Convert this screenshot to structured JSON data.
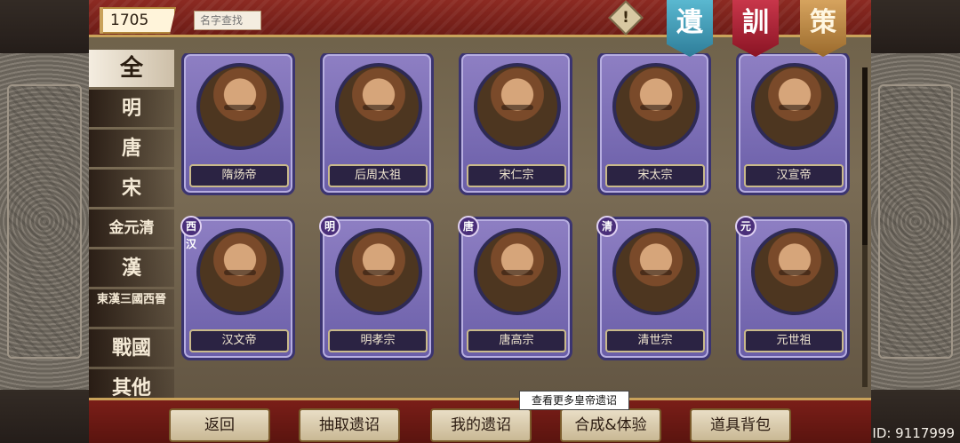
{
  "top": {
    "currency": "1705",
    "search_placeholder": "名字查找",
    "alert_glyph": "!",
    "banners": [
      "遺",
      "訓",
      "策"
    ]
  },
  "categories": [
    {
      "label": "全",
      "active": true
    },
    {
      "label": "明"
    },
    {
      "label": "唐"
    },
    {
      "label": "宋"
    },
    {
      "label": "金元清"
    },
    {
      "label": "漢"
    },
    {
      "label": "東漢三國西晉"
    },
    {
      "label": "戰國"
    },
    {
      "label": "其他"
    }
  ],
  "cards": [
    {
      "name": "隋炀帝",
      "badge": ""
    },
    {
      "name": "后周太祖",
      "badge": ""
    },
    {
      "name": "宋仁宗",
      "badge": ""
    },
    {
      "name": "宋太宗",
      "badge": ""
    },
    {
      "name": "汉宣帝",
      "badge": ""
    },
    {
      "name": "汉文帝",
      "badge": "西汉"
    },
    {
      "name": "明孝宗",
      "badge": "明"
    },
    {
      "name": "唐高宗",
      "badge": "唐"
    },
    {
      "name": "清世宗",
      "badge": "清"
    },
    {
      "name": "元世祖",
      "badge": "元"
    }
  ],
  "bottom": {
    "buttons": [
      "返回",
      "抽取遗诏",
      "我的遗诏",
      "合成&体验",
      "道具背包"
    ],
    "tooltip": "查看更多皇帝遗诏",
    "id_text": "ID: 9117999"
  },
  "colors": {
    "card_frame": "#6a5ea8",
    "banner_blue": "#2e7d99",
    "banner_red": "#8a1424",
    "banner_gold": "#9a6a2c"
  }
}
